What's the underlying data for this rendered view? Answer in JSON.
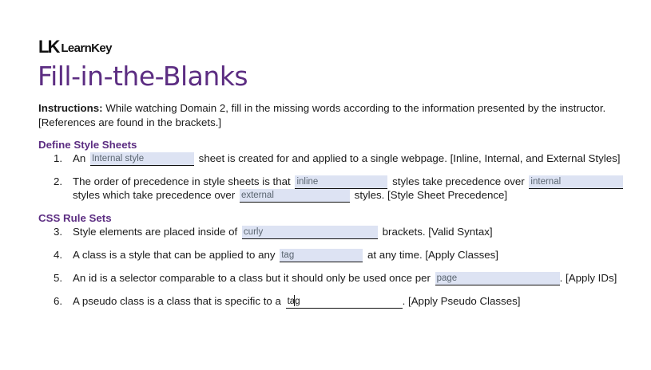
{
  "logo": {
    "mark": "LK",
    "name": "LearnKey"
  },
  "title": "Fill-in-the-Blanks",
  "instructions": {
    "label": "Instructions:",
    "text": " While watching Domain 2, fill in the missing words according to the information presented by the instructor. [References are found in the brackets.]"
  },
  "sections": [
    {
      "heading": "Define Style Sheets",
      "items": [
        {
          "num": "1.",
          "before": "An",
          "blank1": "Internal style",
          "middle": "sheet is created for and applied to a single webpage. [Inline, Internal, and External Styles]"
        },
        {
          "num": "2.",
          "before": "The order of precedence in style sheets is that",
          "blank1": "inline",
          "middle": "styles take precedence over",
          "blank2": "internal",
          "line2_before": "styles which take precedence over",
          "blank3": "external",
          "line2_after": "styles. [Style Sheet Precedence]"
        }
      ]
    },
    {
      "heading": "CSS Rule Sets",
      "items": [
        {
          "num": "3.",
          "before": "Style elements are placed inside of",
          "blank1": "curly",
          "after": "brackets. [Valid Syntax]"
        },
        {
          "num": "4.",
          "before": "A class is a style that can be applied to any",
          "blank1": "tag",
          "after": "at any time. [Apply Classes]"
        },
        {
          "num": "5.",
          "before": "An id is a selector comparable to a class but it should only be used once per",
          "blank1": "page",
          "after": ". [Apply IDs]"
        },
        {
          "num": "6.",
          "before": "A pseudo class is a class that is specific to a",
          "blank1": "tag",
          "after": ". [Apply Pseudo Classes]"
        }
      ]
    }
  ]
}
